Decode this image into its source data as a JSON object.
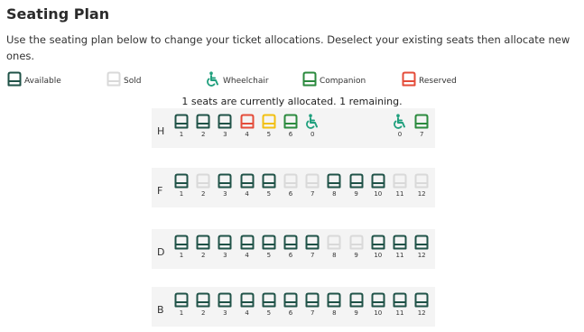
{
  "page": {
    "title": "Seating Plan",
    "description": "Use the seating plan below to change your ticket allocations. Deselect your existing seats then allocate new ones.",
    "status": "1 seats are currently allocated. 1 remaining."
  },
  "colors": {
    "available": "#1f5247",
    "sold": "#d9d9d9",
    "wheelchair": "#21a07e",
    "companion": "#2b8a3e",
    "reserved": "#e44c3a",
    "selected": "#f2c012",
    "band": "#f4f4f4"
  },
  "legend": [
    {
      "label": "Available",
      "type": "available",
      "icon": "seat-icon"
    },
    {
      "label": "Sold",
      "type": "sold",
      "icon": "seat-icon"
    },
    {
      "label": "Wheelchair",
      "type": "wheelchair",
      "icon": "wheelchair-icon"
    },
    {
      "label": "Companion",
      "type": "companion",
      "icon": "seat-icon"
    },
    {
      "label": "Reserved",
      "type": "reserved",
      "icon": "seat-icon"
    }
  ],
  "rows": [
    {
      "letter": "H",
      "seats": [
        {
          "num": "1",
          "type": "available"
        },
        {
          "num": "2",
          "type": "available"
        },
        {
          "num": "3",
          "type": "available"
        },
        {
          "num": "4",
          "type": "reserved"
        },
        {
          "num": "5",
          "type": "selected"
        },
        {
          "num": "6",
          "type": "companion"
        },
        {
          "num": "0",
          "type": "wheelchair"
        },
        {
          "num": "0",
          "type": "wheelchair"
        },
        {
          "num": "7",
          "type": "companion"
        }
      ]
    },
    {
      "letter": "F",
      "seats": [
        {
          "num": "1",
          "type": "available"
        },
        {
          "num": "2",
          "type": "sold"
        },
        {
          "num": "3",
          "type": "available"
        },
        {
          "num": "4",
          "type": "available"
        },
        {
          "num": "5",
          "type": "available"
        },
        {
          "num": "6",
          "type": "sold"
        },
        {
          "num": "7",
          "type": "sold"
        },
        {
          "num": "8",
          "type": "available"
        },
        {
          "num": "9",
          "type": "available"
        },
        {
          "num": "10",
          "type": "available"
        },
        {
          "num": "11",
          "type": "sold"
        },
        {
          "num": "12",
          "type": "sold"
        }
      ]
    },
    {
      "letter": "D",
      "seats": [
        {
          "num": "1",
          "type": "available"
        },
        {
          "num": "2",
          "type": "available"
        },
        {
          "num": "3",
          "type": "available"
        },
        {
          "num": "4",
          "type": "available"
        },
        {
          "num": "5",
          "type": "available"
        },
        {
          "num": "6",
          "type": "available"
        },
        {
          "num": "7",
          "type": "available"
        },
        {
          "num": "8",
          "type": "sold"
        },
        {
          "num": "9",
          "type": "sold"
        },
        {
          "num": "10",
          "type": "available"
        },
        {
          "num": "11",
          "type": "available"
        },
        {
          "num": "12",
          "type": "available"
        }
      ]
    },
    {
      "letter": "B",
      "seats": [
        {
          "num": "1",
          "type": "available"
        },
        {
          "num": "2",
          "type": "available"
        },
        {
          "num": "3",
          "type": "available"
        },
        {
          "num": "4",
          "type": "available"
        },
        {
          "num": "5",
          "type": "available"
        },
        {
          "num": "6",
          "type": "available"
        },
        {
          "num": "7",
          "type": "available"
        },
        {
          "num": "8",
          "type": "available"
        },
        {
          "num": "9",
          "type": "available"
        },
        {
          "num": "10",
          "type": "available"
        },
        {
          "num": "11",
          "type": "available"
        },
        {
          "num": "12",
          "type": "available"
        }
      ]
    }
  ]
}
